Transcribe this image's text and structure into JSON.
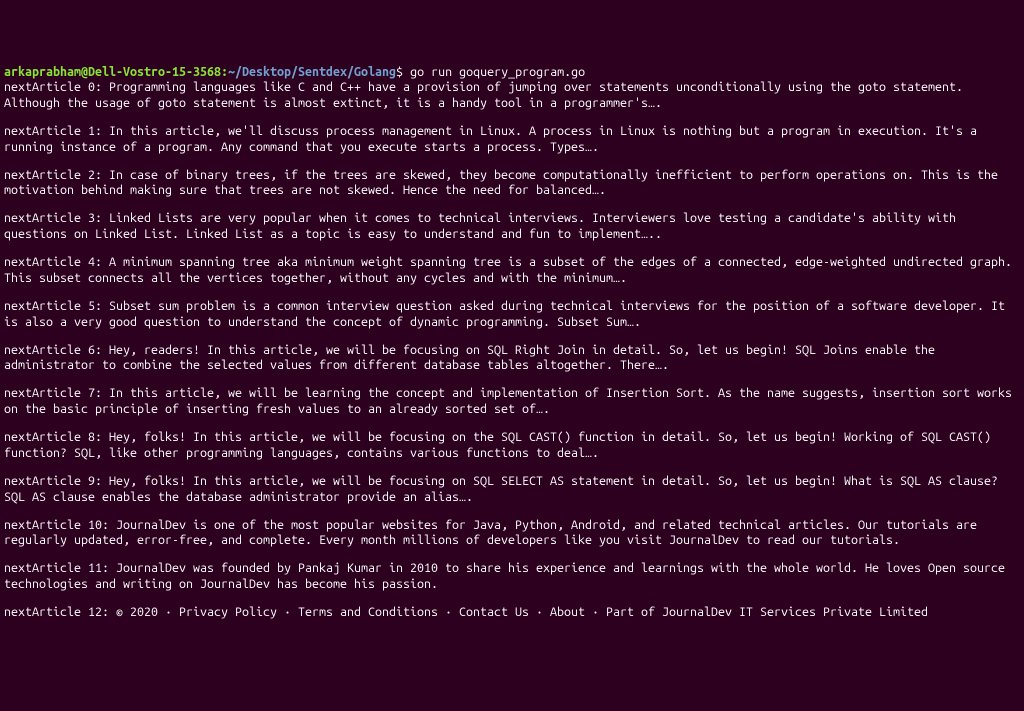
{
  "prompt": {
    "user": "arkaprabham@Dell-Vostro-15-3568",
    "colon": ":",
    "path": "~/Desktop/Sentdex/Golang",
    "sigil": "$",
    "command": "go run goquery_program.go"
  },
  "articles": [
    {
      "label": "nextArticle 0:",
      "text": "Programming languages like C and C++ have a provision of jumping over statements unconditionally using the goto statement. Although the usage of goto statement is almost extinct, it is a handy tool in a programmer's…."
    },
    {
      "label": "nextArticle 1:",
      "text": "In this article, we'll discuss process management in Linux. A process in Linux is nothing but a program in execution. It's a running instance of a program. Any command that you execute starts a process. Types…."
    },
    {
      "label": "nextArticle 2:",
      "text": "In case of binary trees, if the trees are skewed, they become computationally inefficient to perform operations on. This is the motivation behind making sure that trees are not skewed. Hence the need for balanced…."
    },
    {
      "label": "nextArticle 3:",
      "text": "Linked Lists are very popular when it comes to technical interviews. Interviewers love testing a candidate's ability with questions on Linked List. Linked List as a topic is easy to understand and fun to implement….."
    },
    {
      "label": "nextArticle 4:",
      "text": "A minimum spanning tree aka minimum weight spanning tree is a subset of the edges of a connected, edge-weighted undirected graph. This subset connects all the vertices together, without any cycles and with the minimum…."
    },
    {
      "label": "nextArticle 5:",
      "text": "Subset sum problem is a common interview question asked during technical interviews for the position of a software developer. It is also a very good question to understand the concept of dynamic programming. Subset Sum…."
    },
    {
      "label": "nextArticle 6:",
      "text": "Hey, readers! In this article, we will be focusing on SQL Right Join in detail. So, let us begin! SQL Joins enable the administrator to combine the selected values from different database tables altogether. There…."
    },
    {
      "label": "nextArticle 7:",
      "text": "In this article, we will be learning the concept and implementation of Insertion Sort. As the name suggests, insertion sort works on the basic principle of inserting fresh values to an already sorted set of…."
    },
    {
      "label": "nextArticle 8:",
      "text": "Hey, folks! In this article, we will be focusing on the SQL CAST() function in detail. So, let us begin! Working of SQL CAST() function? SQL, like other programming languages, contains various functions to deal…."
    },
    {
      "label": "nextArticle 9:",
      "text": "Hey, folks! In this article, we will be focusing on SQL SELECT AS statement in detail. So, let us begin! What is SQL AS clause? SQL AS clause enables the database administrator provide an alias…."
    },
    {
      "label": "nextArticle 10:",
      "text": "JournalDev is one of the most popular websites for Java, Python, Android, and related technical articles. Our tutorials are regularly updated, error-free, and complete. Every month millions of developers like you visit JournalDev to read our tutorials."
    },
    {
      "label": "nextArticle 11:",
      "text": "JournalDev was founded by Pankaj Kumar in 2010 to share his experience and learnings with the whole world. He loves Open source technologies and writing on JournalDev has become his passion."
    },
    {
      "label": "nextArticle 12:",
      "text": "© 2020 · Privacy Policy · Terms and Conditions · Contact Us · About · Part of JournalDev IT Services Private Limited"
    }
  ]
}
